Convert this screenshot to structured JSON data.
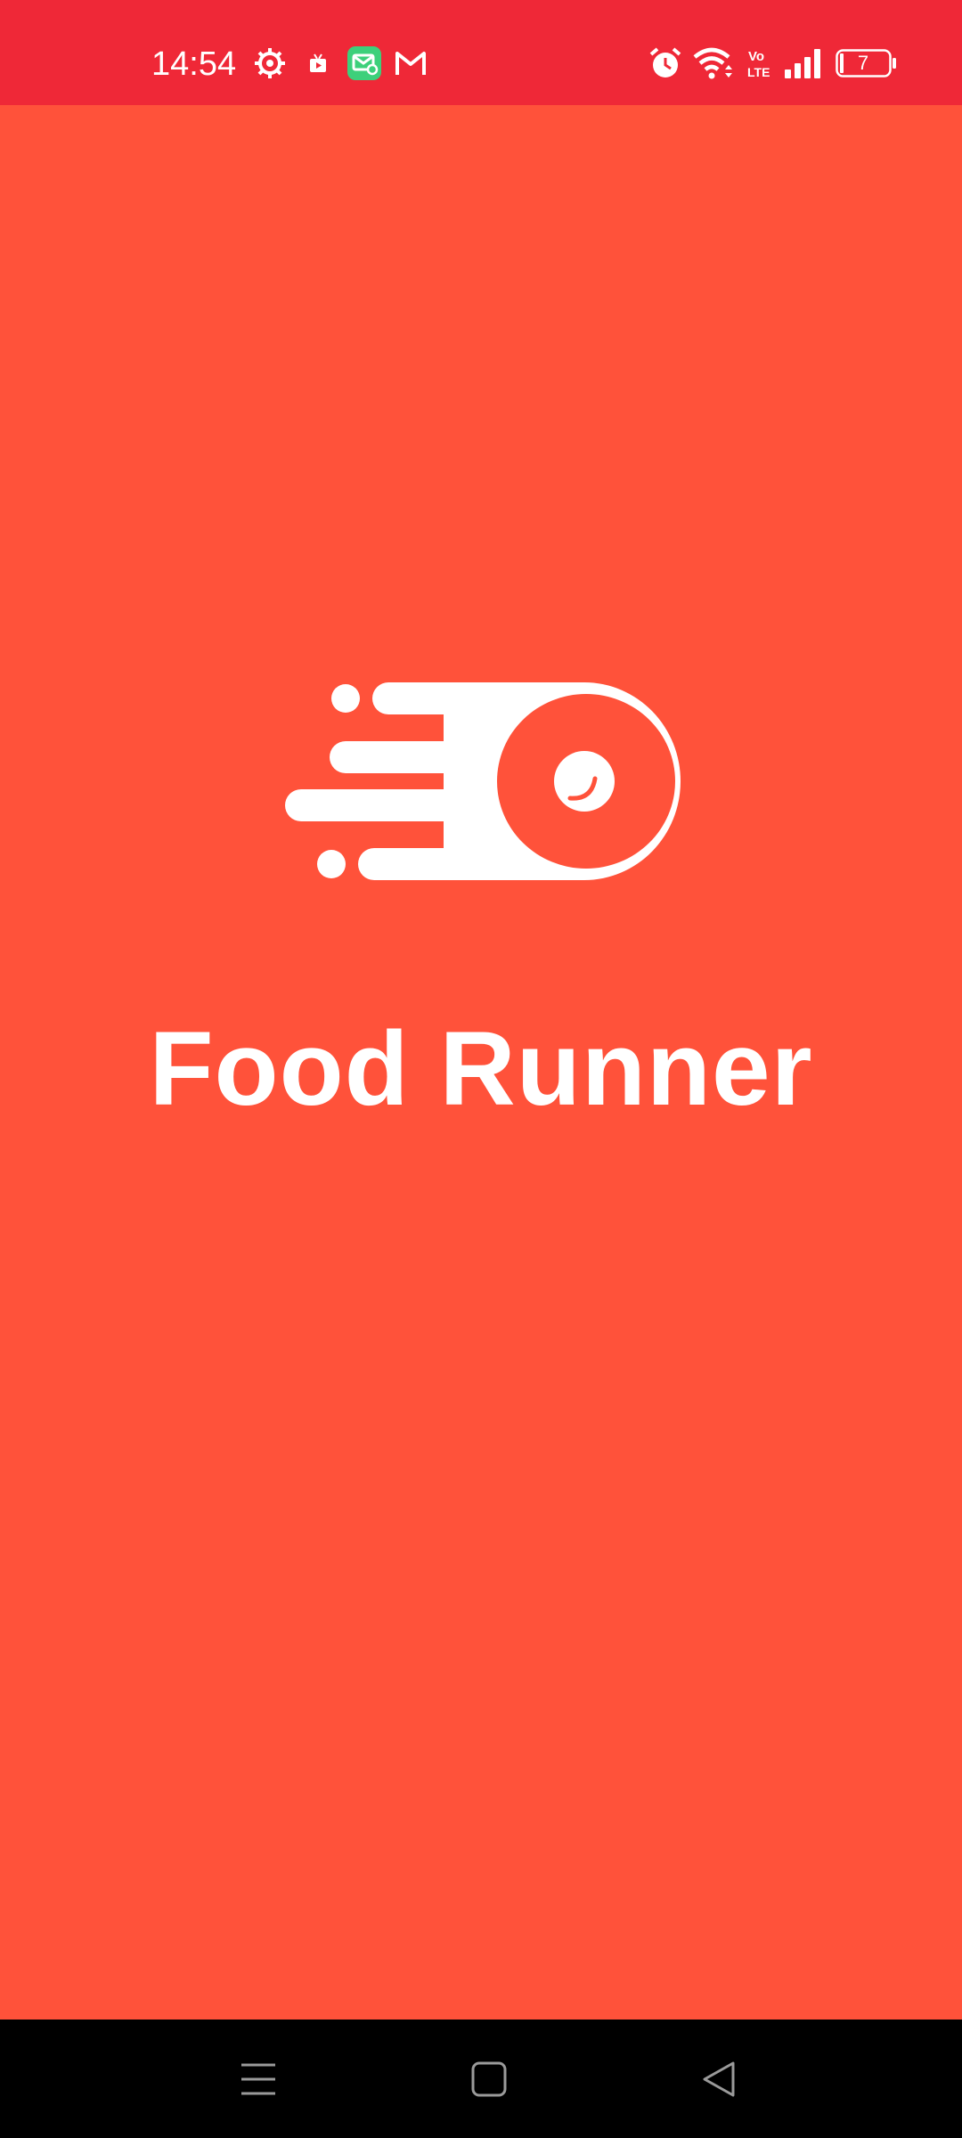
{
  "status_bar": {
    "time": "14:54",
    "battery_level": "7",
    "bar_color": "#EF2837",
    "left_icons": [
      "settings-icon",
      "video-icon",
      "messages-icon",
      "gmail-icon"
    ],
    "right_icons": [
      "alarm-icon",
      "wifi-icon",
      "volte-icon",
      "signal-icon",
      "battery-icon"
    ]
  },
  "splash": {
    "title": "Food Runner",
    "background_color": "#FF523A",
    "logo_icon": "speeding-plate-icon"
  },
  "nav_bar": {
    "buttons": [
      "menu-button",
      "home-button",
      "back-button"
    ]
  }
}
